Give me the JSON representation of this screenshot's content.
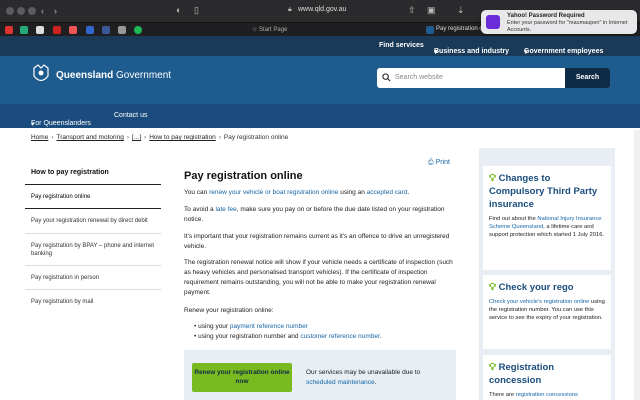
{
  "browser": {
    "url": "www.qld.gov.au",
    "tabs": [
      "Start Page",
      "Pay registration on"
    ],
    "notification": {
      "title": "Yahoo! Password Required",
      "body": "Enter your password for \"maumaupen\" in Internet Accounts."
    }
  },
  "topnav": {
    "find_services": "Find services",
    "business": "Business and industry",
    "government": "Government employees"
  },
  "header": {
    "logo_bold": "Queensland",
    "logo_light": " Government",
    "search_placeholder": "Search website",
    "search_button": "Search"
  },
  "subnav": {
    "for_queenslanders": "For Queenslanders",
    "contact": "Contact us"
  },
  "breadcrumb": {
    "home": "Home",
    "transport": "Transport and motoring",
    "ellipsis": "[...]",
    "how_to_pay": "How to pay registration",
    "current": "Pay registration online"
  },
  "sidenav": {
    "heading": "How to pay registration",
    "items": [
      "Pay registration online",
      "Pay your registration renewal by direct debit",
      "Pay registration by BPAY – phone and internet banking",
      "Pay registration in person",
      "Pay registration by mail"
    ]
  },
  "main": {
    "print": "Print",
    "title": "Pay registration online",
    "p1_a": "You can ",
    "p1_link1": "renew your vehicle or boat registration online",
    "p1_b": " using an ",
    "p1_link2": "accepted card",
    "p1_c": ".",
    "p2_a": "To avoid a ",
    "p2_link": "late fee",
    "p2_b": ", make sure you pay on or before the due date listed on your registration notice.",
    "p3": "It's important that your registration remains current as it's an offence to drive an unregistered vehicle.",
    "p4": "The registration renewal notice will show if your vehicle needs a certificate of inspection (such as heavy vehicles and personalised transport vehicles). If the certificate of inspection requirement remains outstanding, you will not be able to make your registration renewal payment.",
    "p5": "Renew your registration online:",
    "li1_a": "using your ",
    "li1_link": "payment reference number",
    "li2_a": "using your registration number and ",
    "li2_link": "customer reference number",
    "li2_b": ".",
    "renew_button": "Renew your registration online now",
    "callout_a": "Our services may be unavailable due to ",
    "callout_link": "scheduled maintenance",
    "callout_b": "."
  },
  "right": {
    "card1_title": "Changes to Compulsory Third Party insurance",
    "card1_a": "Find out about the ",
    "card1_link": "National Injury Insurance Scheme Queensland",
    "card1_b": ", a lifetime care and support protection which started 1 July 2016.",
    "card2_title": "Check your rego",
    "card2_link": "Check your vehicle's registration online",
    "card2_b": " using the registration number. You can use this service to see the expiry of your registration.",
    "card3_title": "Registration concession",
    "card3_a": "There are ",
    "card3_link": "registration concessions"
  },
  "colors": {
    "header_blue": "#1e5b8f",
    "topnav_navy": "#1b3a58",
    "accent_green": "#78ba1f",
    "link_blue": "#1565a7"
  }
}
